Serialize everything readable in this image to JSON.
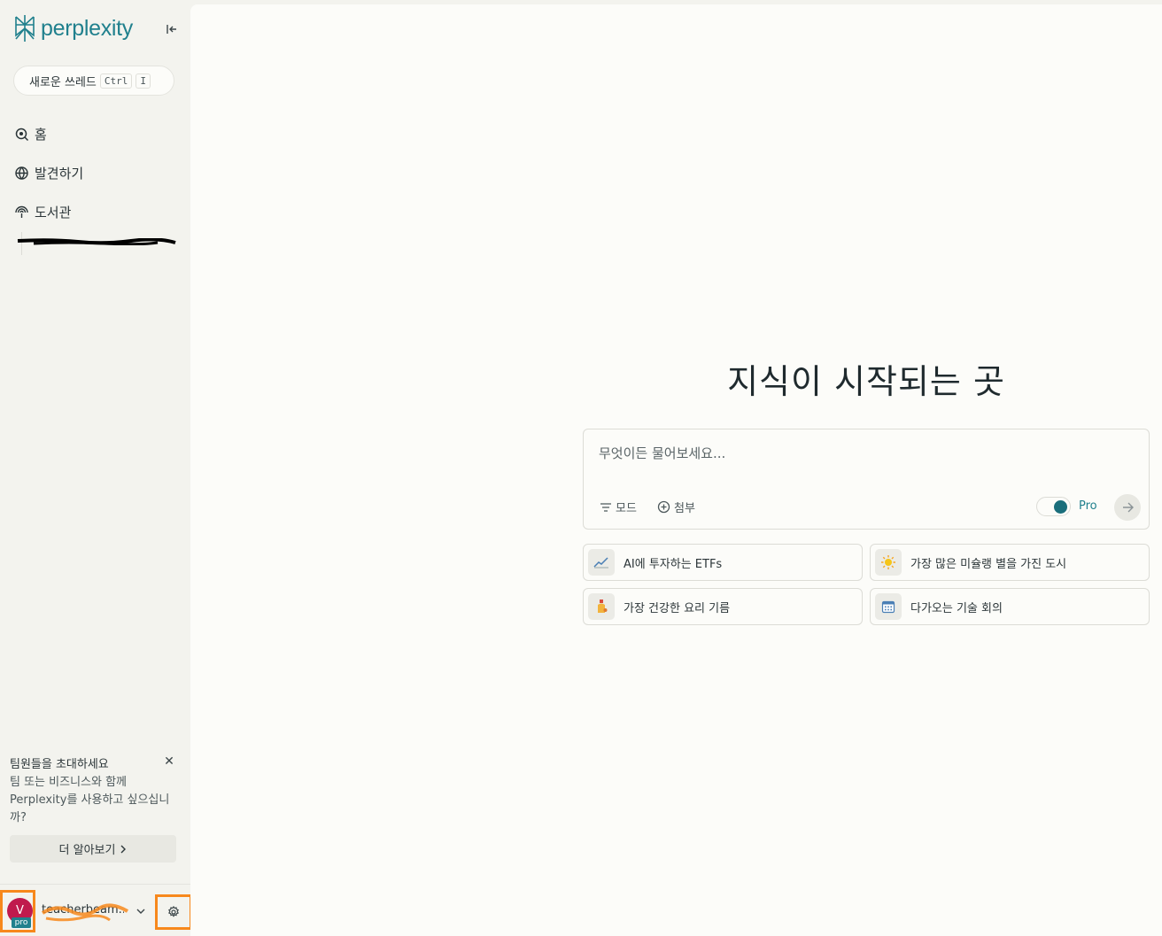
{
  "brand": {
    "name": "perplexity",
    "color": "#20808d"
  },
  "sidebar": {
    "new_thread": {
      "label": "새로운 쓰레드",
      "shortcut": [
        "Ctrl",
        "I"
      ]
    },
    "nav": [
      {
        "label": "홈",
        "icon": "home-search-icon"
      },
      {
        "label": "발견하기",
        "icon": "globe-icon"
      },
      {
        "label": "도서관",
        "icon": "library-icon"
      }
    ],
    "invite": {
      "title": "팀원들을 초대하세요",
      "body": "팀 또는 비즈니스와 함께 Perplexity를 사용하고 싶으십니까?",
      "learn_more": "더 알아보기"
    },
    "user": {
      "avatar_letter": "V",
      "badge": "pro",
      "name": "teacherbeam..."
    }
  },
  "main": {
    "hero": "지식이 시작되는 곳",
    "search": {
      "placeholder": "무엇이든 물어보세요...",
      "mode_label": "모드",
      "attach_label": "첨부",
      "pro_label": "Pro",
      "pro_enabled": true
    },
    "suggestions": [
      {
        "label": "AI에 투자하는 ETFs",
        "icon": "chart-icon"
      },
      {
        "label": "가장 많은 미슐랭 별을 가진 도시",
        "icon": "sun-icon"
      },
      {
        "label": "가장 건강한 요리 기름",
        "icon": "oil-bottle-icon"
      },
      {
        "label": "다가오는 기술 회의",
        "icon": "calendar-icon"
      }
    ]
  },
  "colors": {
    "accent": "#20808d",
    "highlight": "#f7881c",
    "avatar": "#c01a4d"
  }
}
